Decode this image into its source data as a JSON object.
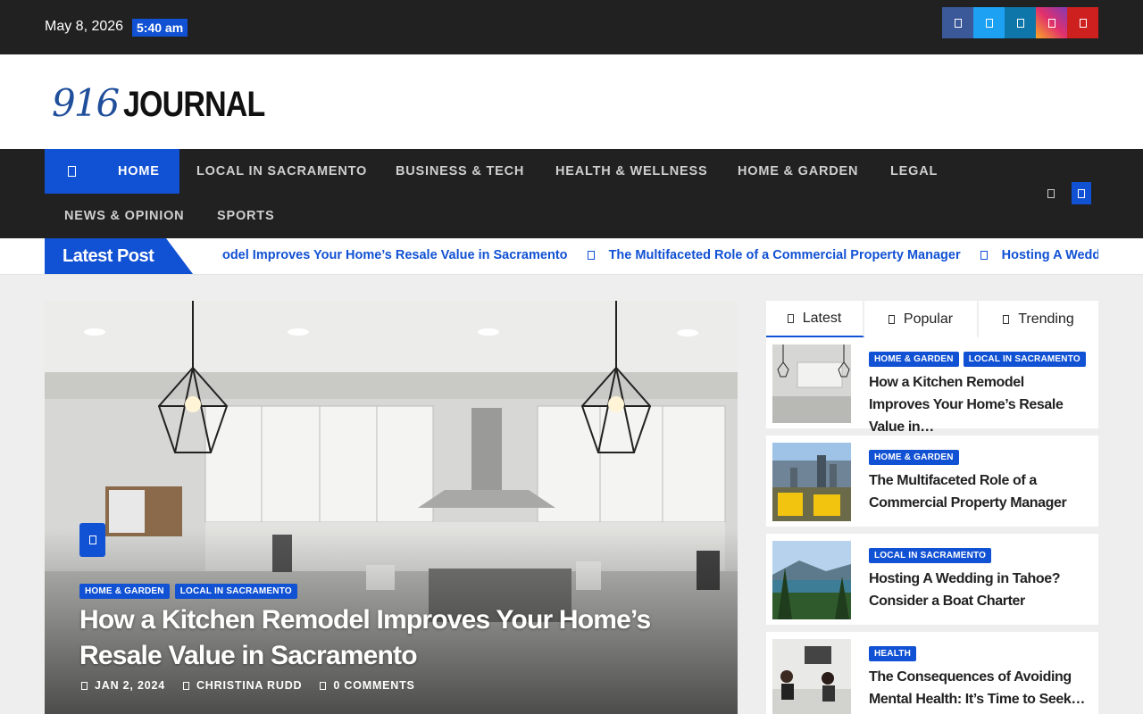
{
  "topbar": {
    "date": "May 8, 2026",
    "time": "5:40 am",
    "social": [
      {
        "name": "facebook-icon",
        "color": "#3b5998"
      },
      {
        "name": "twitter-icon",
        "color": "#1da1f2"
      },
      {
        "name": "linkedin-icon",
        "color": "#0e76a8"
      },
      {
        "name": "instagram-icon",
        "color": "#e1306c"
      },
      {
        "name": "youtube-icon",
        "color": "#cd201f"
      }
    ]
  },
  "logo": {
    "number": "916",
    "word": "JOURNAL"
  },
  "nav": {
    "items": [
      {
        "label": "HOME",
        "active": true
      },
      {
        "label": "LOCAL IN SACRAMENTO"
      },
      {
        "label": "BUSINESS & TECH"
      },
      {
        "label": "HEALTH & WELLNESS"
      },
      {
        "label": "HOME & GARDEN"
      },
      {
        "label": "LEGAL"
      },
      {
        "label": "NEWS & OPINION"
      },
      {
        "label": "SPORTS"
      }
    ]
  },
  "latest": {
    "label": "Latest Post",
    "ticker": [
      "emodel Improves Your Home’s Resale Value in Sacramento",
      "The Multifaceted Role of a Commercial Property Manager",
      "Hosting A Wedding"
    ]
  },
  "hero": {
    "categories": [
      "HOME & GARDEN",
      "LOCAL IN SACRAMENTO"
    ],
    "title": "How a Kitchen Remodel Improves Your Home’s Resale Value in Sacramento",
    "date": "JAN 2, 2024",
    "author": "CHRISTINA RUDD",
    "comments": "0 COMMENTS"
  },
  "sidebar": {
    "tabs": [
      "Latest",
      "Popular",
      "Trending"
    ],
    "posts": [
      {
        "categories": [
          "HOME & GARDEN",
          "LOCAL IN SACRAMENTO"
        ],
        "title": "How a Kitchen Remodel Improves Your Home’s Resale Value in…"
      },
      {
        "categories": [
          "HOME & GARDEN"
        ],
        "title": "The Multifaceted Role of a Commercial Property Manager"
      },
      {
        "categories": [
          "LOCAL IN SACRAMENTO"
        ],
        "title": "Hosting A Wedding in Tahoe? Consider a Boat Charter"
      },
      {
        "categories": [
          "HEALTH"
        ],
        "title": "The Consequences of Avoiding Mental Health: It’s Time to Seek…"
      }
    ]
  },
  "colors": {
    "accent": "#1151d3",
    "dark": "#212121"
  }
}
